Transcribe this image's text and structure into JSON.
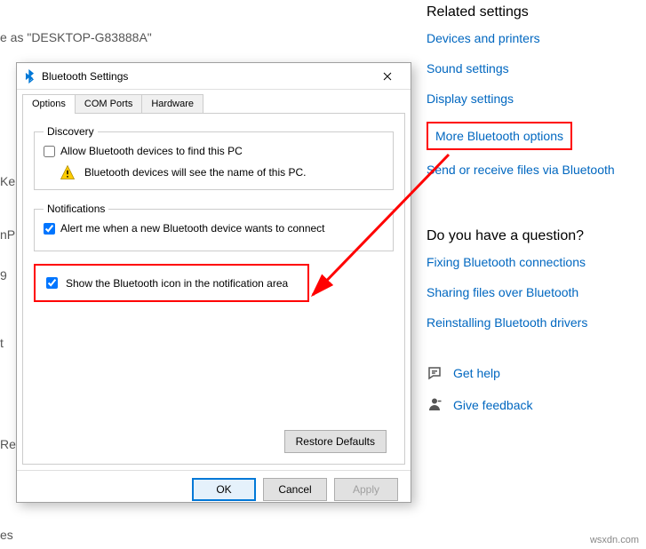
{
  "background": {
    "desktop_name": "e as \"DESKTOP-G83888A\"",
    "ke_fragment": "Ke",
    "np_fragment": "nP",
    "zero_fragment": "9",
    "t_fragment": "t",
    "re_fragment": "Re",
    "es_fragment": "es"
  },
  "sidebar": {
    "heading1": "Related settings",
    "links": [
      "Devices and printers",
      "Sound settings",
      "Display settings",
      "More Bluetooth options",
      "Send or receive files via Bluetooth"
    ],
    "heading2": "Do you have a question?",
    "qlinks": [
      "Fixing Bluetooth connections",
      "Sharing files over Bluetooth",
      "Reinstalling Bluetooth drivers"
    ],
    "help": "Get help",
    "feedback": "Give feedback"
  },
  "dialog": {
    "title": "Bluetooth Settings",
    "tabs": [
      "Options",
      "COM Ports",
      "Hardware"
    ],
    "discovery": {
      "legend": "Discovery",
      "check1": "Allow Bluetooth devices to find this PC",
      "info": "Bluetooth devices will see the name of this PC."
    },
    "notifications": {
      "legend": "Notifications",
      "check1": "Alert me when a new Bluetooth device wants to connect"
    },
    "standalone_check": "Show the Bluetooth icon in the notification area",
    "restore": "Restore Defaults",
    "buttons": {
      "ok": "OK",
      "cancel": "Cancel",
      "apply": "Apply"
    }
  },
  "watermark": "wsxdn.com"
}
